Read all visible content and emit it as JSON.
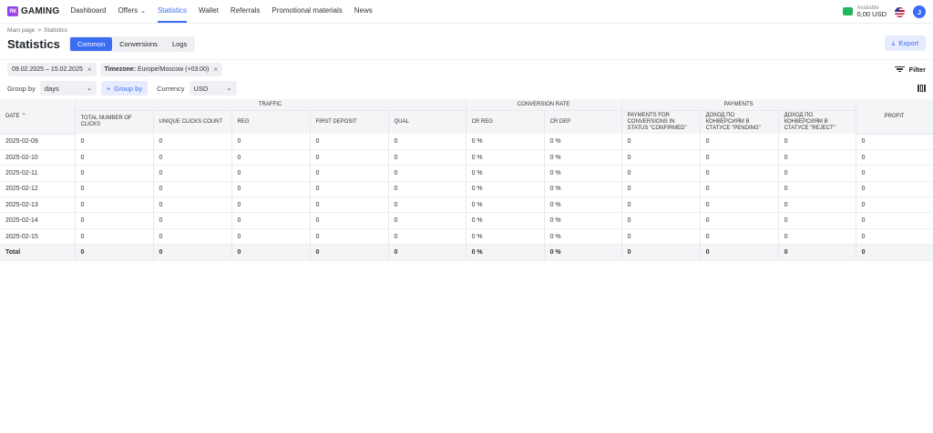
{
  "brand": {
    "mark": "ЯК",
    "name": "GAMING"
  },
  "nav": {
    "items": [
      {
        "label": "Dashboard",
        "active": false
      },
      {
        "label": "Offers",
        "active": false,
        "dropdown": true
      },
      {
        "label": "Statistics",
        "active": true
      },
      {
        "label": "Wallet",
        "active": false
      },
      {
        "label": "Referrals",
        "active": false
      },
      {
        "label": "Promotional materials",
        "active": false
      },
      {
        "label": "News",
        "active": false
      }
    ]
  },
  "account": {
    "balance_label": "Available",
    "balance_value": "0,00 USD",
    "avatar_initial": "J"
  },
  "breadcrumb": {
    "home": "Main page",
    "separator": ">",
    "current": "Statistics"
  },
  "page": {
    "title": "Statistics"
  },
  "tabs": [
    {
      "label": "Common",
      "active": true
    },
    {
      "label": "Conversions",
      "active": false
    },
    {
      "label": "Logs",
      "active": false
    }
  ],
  "export_label": "Export",
  "filters": {
    "date_range": "09.02.2025 – 15.02.2025",
    "timezone_label": "Timezone:",
    "timezone_value": "Europe/Moscow (+03:00)",
    "filter_label": "Filter"
  },
  "grouping": {
    "group_by_label": "Group by",
    "group_by_value": "days",
    "group_by_button": "Group by",
    "currency_label": "Currency",
    "currency_value": "USD"
  },
  "table": {
    "groups": {
      "traffic": "Traffic",
      "conversion_rate": "Conversion Rate",
      "payments": "Payments"
    },
    "columns": {
      "date": "Date",
      "total_clicks": "Total number of clicks",
      "unique_clicks": "Unique clicks count",
      "reg": "Reg",
      "first_deposit": "First deposit",
      "qual": "Qual",
      "cr_reg": "CR Reg",
      "cr_dep": "CR Dep",
      "pay_confirmed": "Payments for conversions in status \"Confirmed\"",
      "pay_pending": "Доход по конверсиям в статусе \"Pending\"",
      "pay_reject": "Доход по конверсиям в статусе \"Reject\"",
      "profit": "Profit"
    },
    "rows": [
      [
        "2025-02-09",
        "0",
        "0",
        "0",
        "0",
        "0",
        "0 %",
        "0 %",
        "0",
        "0",
        "0",
        "0"
      ],
      [
        "2025-02-10",
        "0",
        "0",
        "0",
        "0",
        "0",
        "0 %",
        "0 %",
        "0",
        "0",
        "0",
        "0"
      ],
      [
        "2025-02-11",
        "0",
        "0",
        "0",
        "0",
        "0",
        "0 %",
        "0 %",
        "0",
        "0",
        "0",
        "0"
      ],
      [
        "2025-02-12",
        "0",
        "0",
        "0",
        "0",
        "0",
        "0 %",
        "0 %",
        "0",
        "0",
        "0",
        "0"
      ],
      [
        "2025-02-13",
        "0",
        "0",
        "0",
        "0",
        "0",
        "0 %",
        "0 %",
        "0",
        "0",
        "0",
        "0"
      ],
      [
        "2025-02-14",
        "0",
        "0",
        "0",
        "0",
        "0",
        "0 %",
        "0 %",
        "0",
        "0",
        "0",
        "0"
      ],
      [
        "2025-02-15",
        "0",
        "0",
        "0",
        "0",
        "0",
        "0 %",
        "0 %",
        "0",
        "0",
        "0",
        "0"
      ]
    ],
    "total": [
      "Total",
      "0",
      "0",
      "0",
      "0",
      "0",
      "0 %",
      "0 %",
      "0",
      "0",
      "0",
      "0"
    ]
  },
  "colors": {
    "accent": "#3b6ef5",
    "wallet": "#22b65e"
  }
}
